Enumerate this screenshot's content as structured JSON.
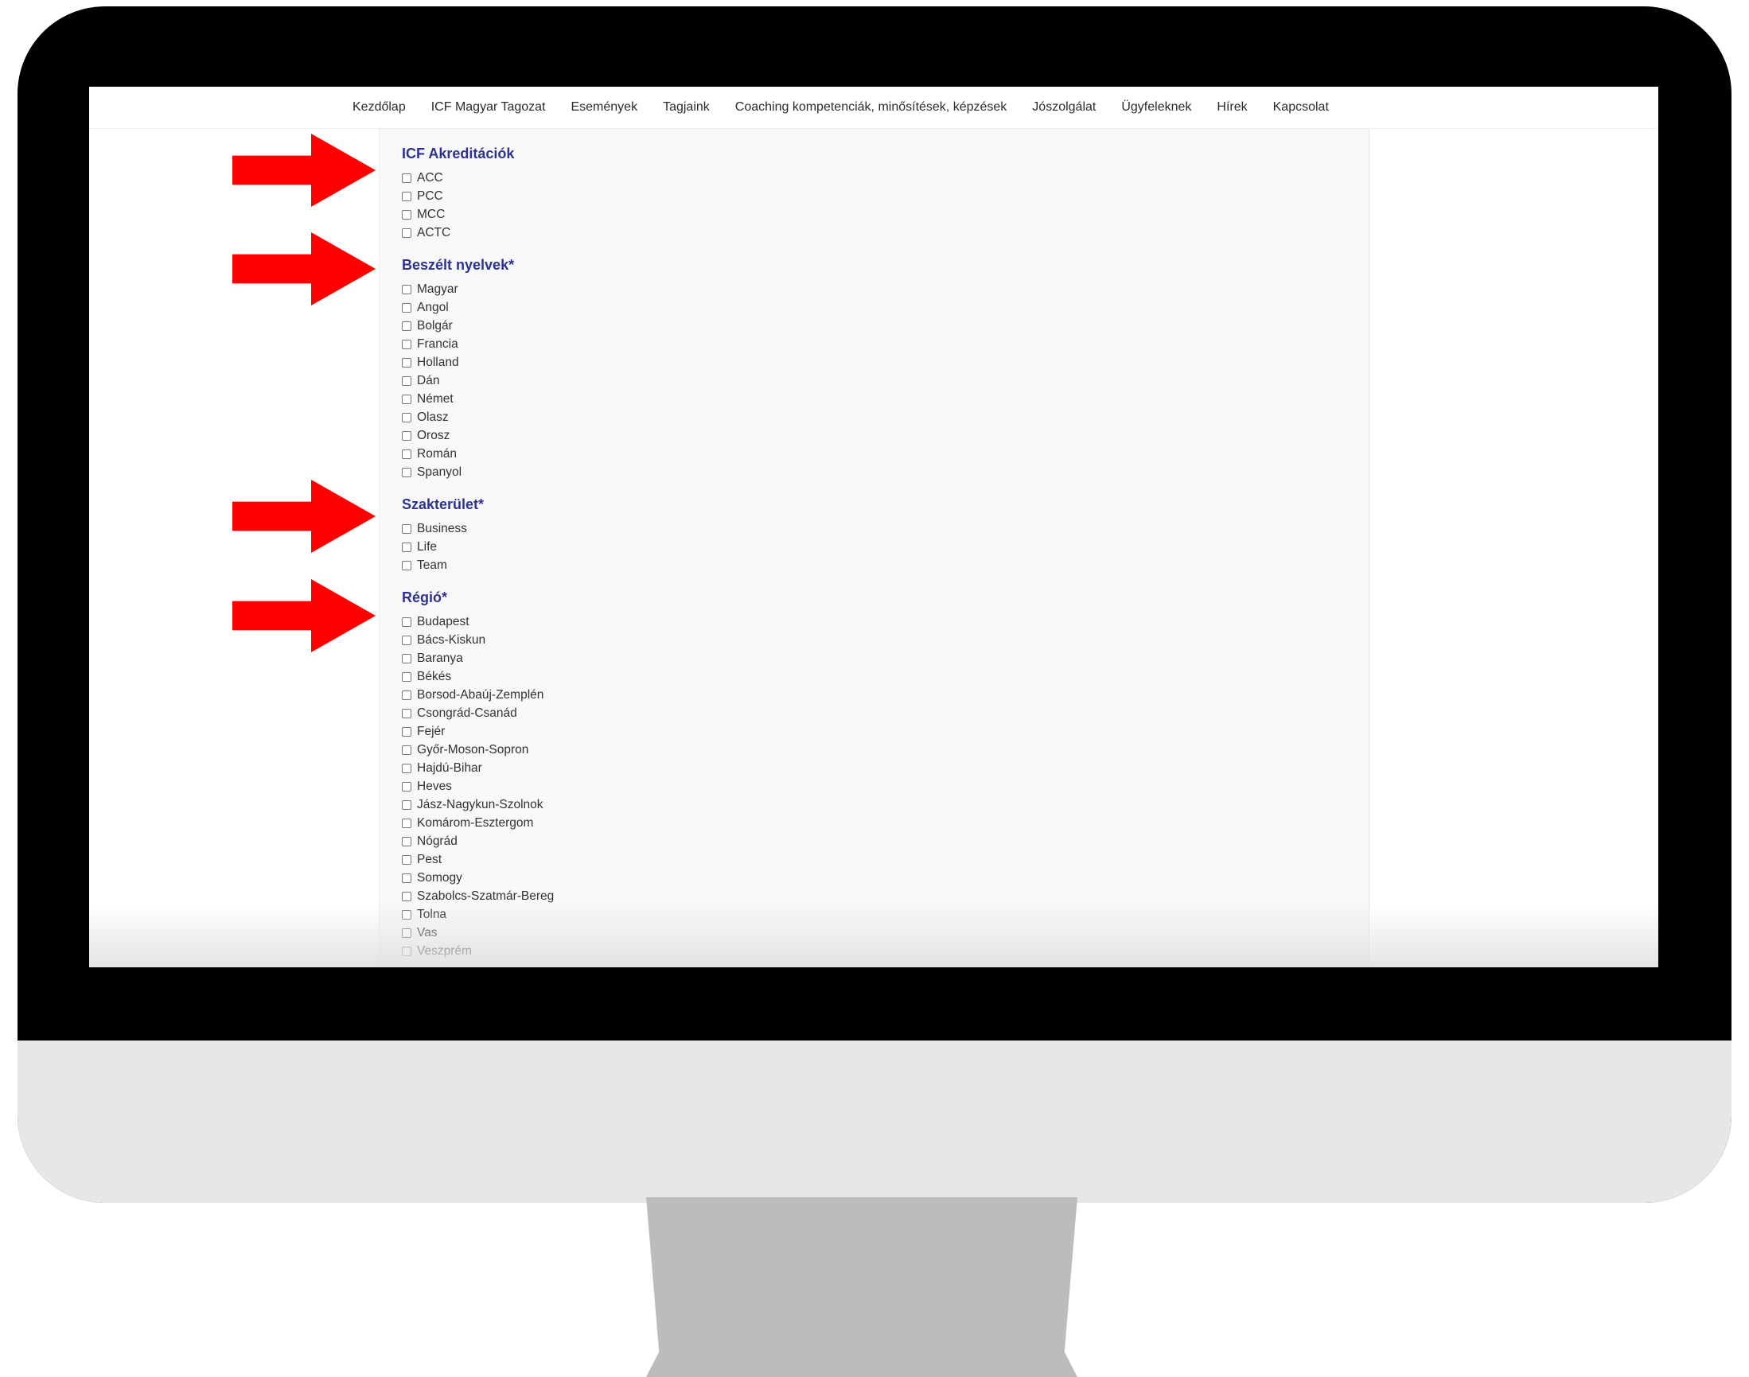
{
  "nav": {
    "items": [
      "Kezdőlap",
      "ICF Magyar Tagozat",
      "Események",
      "Tagjaink",
      "Coaching kompetenciák, minősítések, képzések",
      "Jószolgálat",
      "Ügyfeleknek",
      "Hírek",
      "Kapcsolat"
    ]
  },
  "sections": [
    {
      "title": "ICF Akreditációk",
      "options": [
        "ACC",
        "PCC",
        "MCC",
        "ACTC"
      ]
    },
    {
      "title": "Beszélt nyelvek*",
      "options": [
        "Magyar",
        "Angol",
        "Bolgár",
        "Francia",
        "Holland",
        "Dán",
        "Német",
        "Olasz",
        "Orosz",
        "Román",
        "Spanyol"
      ]
    },
    {
      "title": "Szakterület*",
      "options": [
        "Business",
        "Life",
        "Team"
      ]
    },
    {
      "title": "Régió*",
      "options": [
        "Budapest",
        "Bács-Kiskun",
        "Baranya",
        "Békés",
        "Borsod-Abaúj-Zemplén",
        "Csongrád-Csanád",
        "Fejér",
        "Győr-Moson-Sopron",
        "Hajdú-Bihar",
        "Heves",
        "Jász-Nagykun-Szolnok",
        "Komárom-Esztergom",
        "Nógrád",
        "Pest",
        "Somogy",
        "Szabolcs-Szatmár-Bereg",
        "Tolna",
        "Vas",
        "Veszprém"
      ]
    }
  ],
  "colors": {
    "section_title": "#2e3192",
    "arrow": "#ff0000",
    "bezel": "#000000",
    "chin": "#e7e7e7",
    "stand": "#bcbcbc"
  },
  "icons": {
    "annotation": "red-arrow-icon",
    "option": "checkbox"
  }
}
